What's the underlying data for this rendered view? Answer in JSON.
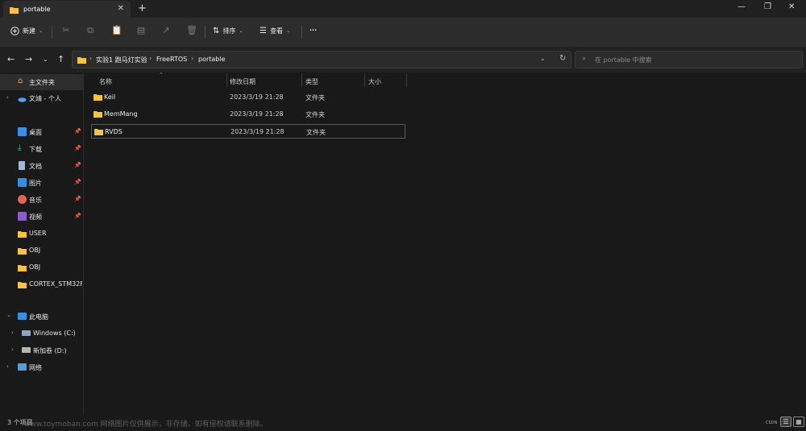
{
  "window": {
    "tab_title": "portable",
    "tab_close": "✕",
    "new_tab": "+",
    "minimize": "—",
    "maximize": "❐",
    "close": "✕"
  },
  "toolbar": {
    "new_label": "新建",
    "sort_label": "排序",
    "view_label": "查看",
    "more_label": "···"
  },
  "address": {
    "crumbs": [
      "实验1 跑马灯实验",
      "FreeRTOS",
      "portable"
    ],
    "search_placeholder": "在 portable 中搜索"
  },
  "sidebar": {
    "items": [
      {
        "label": "主文件夹"
      },
      {
        "label": "文靖 - 个人"
      },
      {
        "label": "桌面"
      },
      {
        "label": "下载"
      },
      {
        "label": "文档"
      },
      {
        "label": "图片"
      },
      {
        "label": "音乐"
      },
      {
        "label": "视频"
      },
      {
        "label": "USER"
      },
      {
        "label": "OBJ"
      },
      {
        "label": "OBJ"
      },
      {
        "label": "CORTEX_STM32F"
      },
      {
        "label": "此电脑"
      },
      {
        "label": "Windows (C:)"
      },
      {
        "label": "新加卷 (D:)"
      },
      {
        "label": "网络"
      }
    ]
  },
  "columns": {
    "name": "名称",
    "date": "修改日期",
    "type": "类型",
    "size": "大小"
  },
  "files": [
    {
      "name": "Keil",
      "date": "2023/3/19 21:28",
      "type": "文件夹"
    },
    {
      "name": "MemMang",
      "date": "2023/3/19 21:28",
      "type": "文件夹"
    },
    {
      "name": "RVDS",
      "date": "2023/3/19 21:28",
      "type": "文件夹"
    }
  ],
  "status": {
    "count": "3 个项目",
    "watermark": "www.toymoban.com 网络图片仅供展示，非存储，如有侵权请联系删除。",
    "csdn": "CSDN"
  },
  "colors": {
    "folder": "#f5c242",
    "accent": "#4aa3ff"
  }
}
